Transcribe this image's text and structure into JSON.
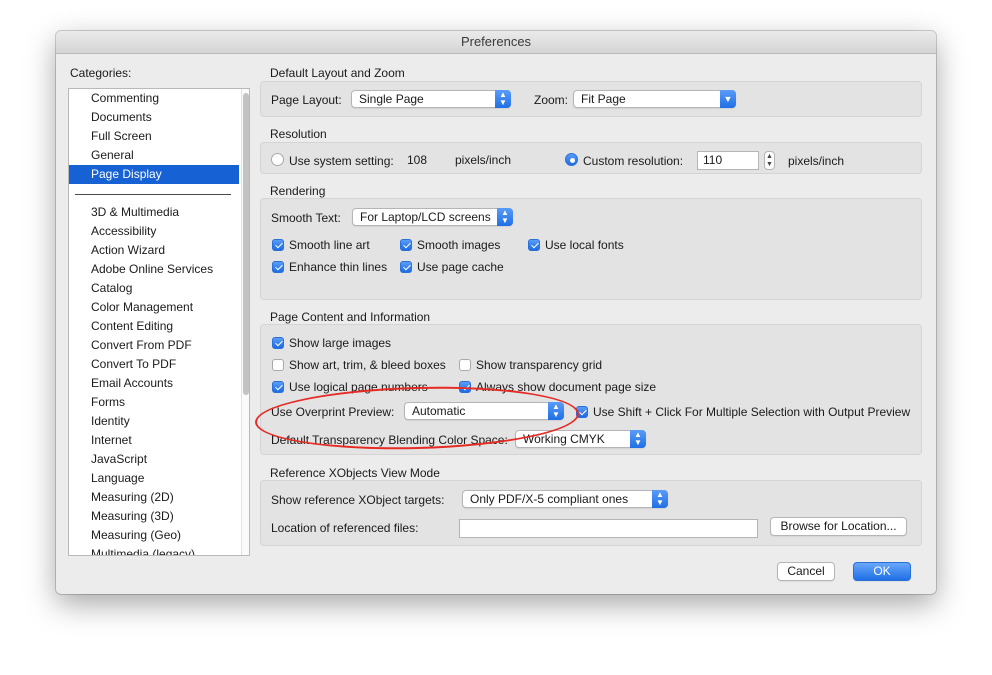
{
  "window": {
    "title": "Preferences"
  },
  "categories": {
    "heading": "Categories:",
    "top_items": [
      "Commenting",
      "Documents",
      "Full Screen",
      "General",
      "Page Display"
    ],
    "selected": "Page Display",
    "more_items": [
      "3D & Multimedia",
      "Accessibility",
      "Action Wizard",
      "Adobe Online Services",
      "Catalog",
      "Color Management",
      "Content Editing",
      "Convert From PDF",
      "Convert To PDF",
      "Email Accounts",
      "Forms",
      "Identity",
      "Internet",
      "JavaScript",
      "Language",
      "Measuring (2D)",
      "Measuring (3D)",
      "Measuring (Geo)",
      "Multimedia (legacy)"
    ]
  },
  "layout_zoom": {
    "title": "Default Layout and Zoom",
    "page_layout_label": "Page Layout:",
    "page_layout_value": "Single Page",
    "zoom_label": "Zoom:",
    "zoom_value": "Fit Page"
  },
  "resolution": {
    "title": "Resolution",
    "system_label": "Use system setting:",
    "system_value": "108",
    "system_unit": "pixels/inch",
    "custom_label": "Custom resolution:",
    "custom_value": "110",
    "custom_unit": "pixels/inch",
    "selected": "custom"
  },
  "rendering": {
    "title": "Rendering",
    "smooth_text_label": "Smooth Text:",
    "smooth_text_value": "For Laptop/LCD screens",
    "smooth_line_art": "Smooth line art",
    "smooth_images": "Smooth images",
    "use_local_fonts": "Use local fonts",
    "enhance_thin_lines": "Enhance thin lines",
    "use_page_cache": "Use page cache"
  },
  "page_content": {
    "title": "Page Content and Information",
    "show_large_images": "Show large images",
    "show_art_trim_bleed": "Show art, trim, & bleed boxes",
    "show_transparency_grid": "Show transparency grid",
    "use_logical_page_numbers": "Use logical page numbers",
    "always_show_page_size": "Always show document page size",
    "overprint_label": "Use Overprint Preview:",
    "overprint_value": "Automatic",
    "shift_click": "Use Shift + Click For Multiple Selection with Output Preview",
    "blending_label": "Default Transparency Blending Color Space:",
    "blending_value": "Working CMYK"
  },
  "xobjects": {
    "title": "Reference XObjects View Mode",
    "targets_label": "Show reference XObject targets:",
    "targets_value": "Only PDF/X-5 compliant ones",
    "location_label": "Location of referenced files:",
    "location_value": "",
    "browse_label": "Browse for Location..."
  },
  "footer": {
    "cancel": "Cancel",
    "ok": "OK"
  },
  "colors": {
    "accent": "#1f6fe6",
    "selection": "#1662d4",
    "annotation": "#e52b24"
  }
}
